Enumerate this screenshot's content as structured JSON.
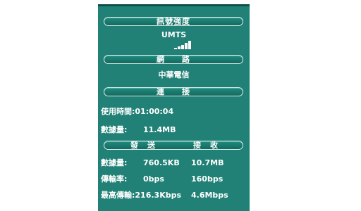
{
  "signal_section": {
    "header": "訊號強度",
    "network_type": "UMTS",
    "signal_bars_level": 5
  },
  "network_section": {
    "header": "網　　路",
    "operator": "中華電信"
  },
  "connection_section": {
    "header": "連　　接",
    "time_label": "使用時間",
    "time_value": ":01:00:04",
    "data_label": "數據量:",
    "data_value": "11.4MB"
  },
  "transfer_section": {
    "send_header": "發　送",
    "receive_header": "接　收",
    "rows": [
      {
        "label": "數據量:",
        "send": "760.5KB",
        "receive": "10.7MB"
      },
      {
        "label": "傳輸率:",
        "send": "0bps",
        "receive": "160bps"
      },
      {
        "label": "最高傳輸",
        "send": ":216.3Kbps",
        "receive": "4.6Mbps"
      }
    ]
  }
}
